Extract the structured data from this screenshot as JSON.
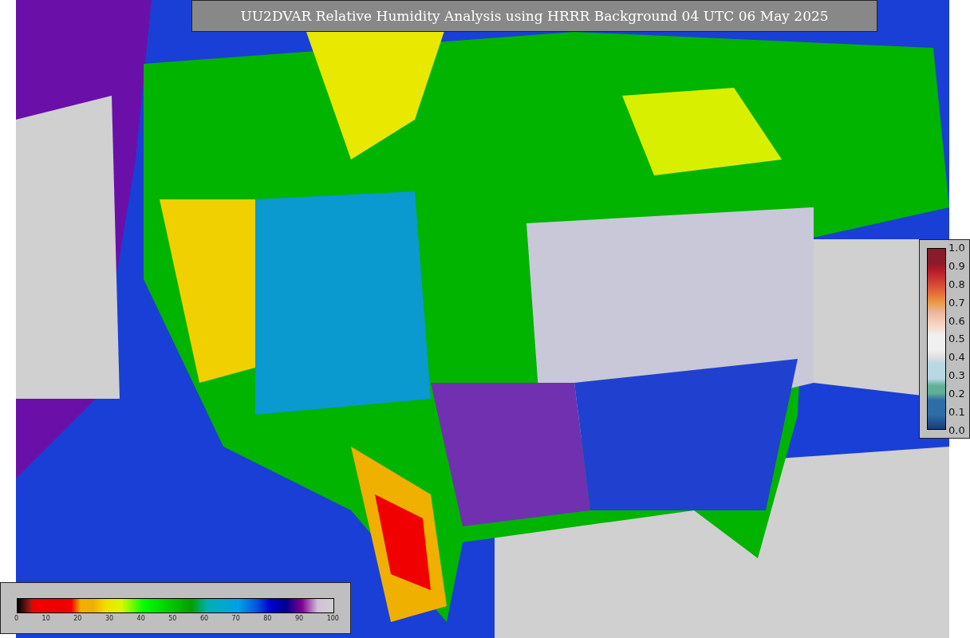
{
  "title": "UU2DVAR Relative Humidity Analysis using HRRR Background 04 UTC 06 May 2025",
  "humidity_colorbar": {
    "ticks": [
      "0",
      "10",
      "20",
      "30",
      "40",
      "50",
      "60",
      "70",
      "80",
      "90",
      "100"
    ]
  },
  "side_colorbar": {
    "ticks": [
      "1.0",
      "0.9",
      "0.8",
      "0.7",
      "0.6",
      "0.5",
      "0.4",
      "0.3",
      "0.2",
      "0.1",
      "0.0"
    ]
  }
}
